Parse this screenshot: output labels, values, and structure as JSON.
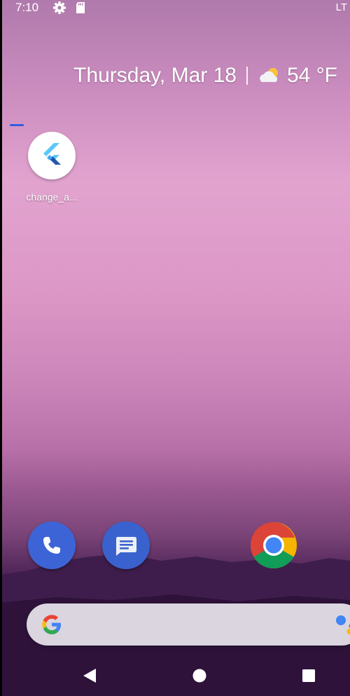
{
  "status_bar": {
    "time": "7:10",
    "icons": [
      "gear-icon",
      "sd-card-icon"
    ],
    "network": "LT"
  },
  "at_a_glance": {
    "date": "Thursday, Mar 18",
    "weather_icon": "partly-cloudy-icon",
    "temperature": "54 °F"
  },
  "home_screen": {
    "shortcuts": [
      {
        "label": "change_a...",
        "icon": "flutter-icon"
      }
    ]
  },
  "dock": {
    "apps": [
      {
        "name": "Phone",
        "icon": "phone-icon"
      },
      {
        "name": "Messages",
        "icon": "messages-icon"
      },
      {
        "name": "Chrome",
        "icon": "chrome-icon"
      }
    ]
  },
  "search_bar": {
    "logo": "google-g-icon",
    "assistant": "assistant-icon"
  },
  "nav_bar": {
    "buttons": [
      "back-icon",
      "home-icon",
      "recents-icon"
    ]
  },
  "colors": {
    "dock_blue": "#3d64d6",
    "drag_indicator": "#3a5bd9"
  }
}
